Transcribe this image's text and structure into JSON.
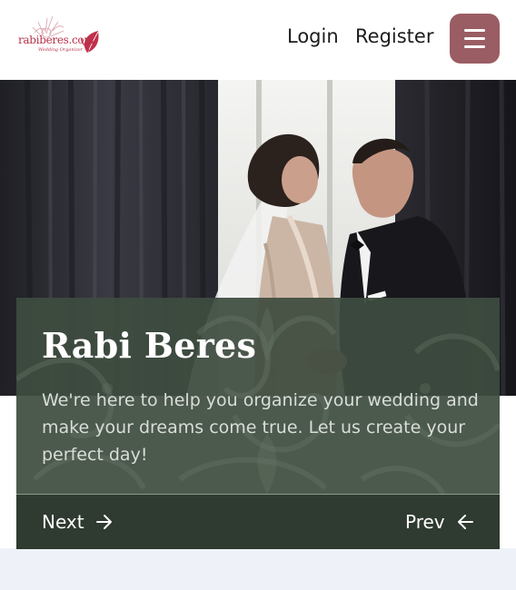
{
  "header": {
    "logo_text": "rabiberes.com",
    "logo_tagline": "Wedding Organizer",
    "login_label": "Login",
    "register_label": "Register",
    "menu_icon": "hamburger-menu-icon"
  },
  "hero": {
    "title": "Rabi Beres",
    "description": "We're here to help you organize your wedding and make your dreams come true. Let us create your perfect day!",
    "next_label": "Next",
    "prev_label": "Prev",
    "next_icon": "arrow-right-icon",
    "prev_icon": "arrow-left-icon"
  },
  "colors": {
    "brand": "#b8334a",
    "menu_button": "#9a5d63",
    "card_bg": "#3e4c40",
    "card_footer": "#2f3a31"
  }
}
